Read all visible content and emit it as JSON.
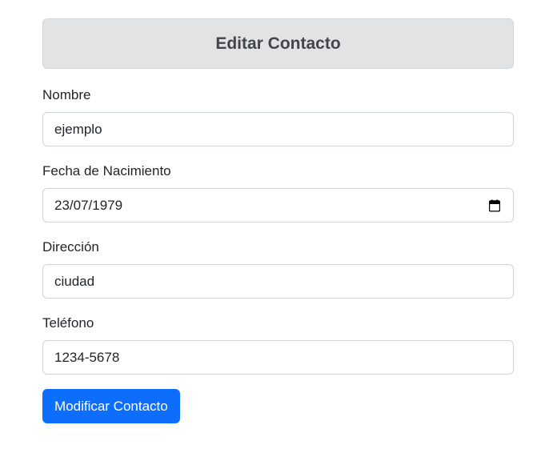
{
  "header": {
    "title": "Editar Contacto"
  },
  "form": {
    "fields": [
      {
        "label": "Nombre",
        "value": "ejemplo"
      },
      {
        "label": "Fecha de Nacimiento",
        "value": "23/07/1979",
        "icon": "calendar-icon"
      },
      {
        "label": "Dirección",
        "value": "ciudad"
      },
      {
        "label": "Teléfono",
        "value": "1234-5678"
      }
    ],
    "submit_label": "Modificar Contacto"
  },
  "colors": {
    "header_bg": "#e2e3e5",
    "header_text": "#41464b",
    "primary": "#0d6efd",
    "input_border": "#ced4da"
  }
}
